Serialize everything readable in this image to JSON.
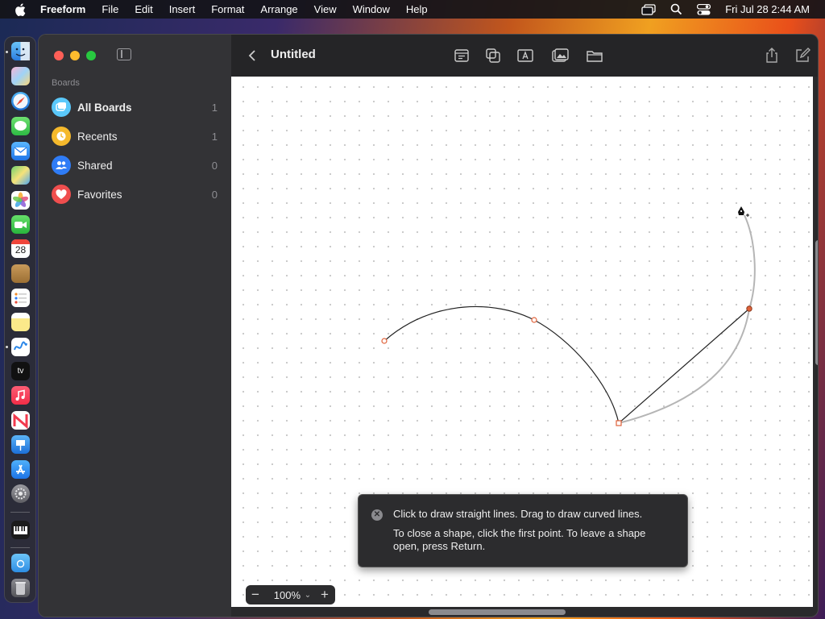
{
  "menubar": {
    "app_name": "Freeform",
    "menus": [
      "File",
      "Edit",
      "Insert",
      "Format",
      "Arrange",
      "View",
      "Window",
      "Help"
    ],
    "clock": "Fri Jul 28  2:44 AM"
  },
  "dock": {
    "calendar_day": "28",
    "tv_label": "tv"
  },
  "sidebar": {
    "section_title": "Boards",
    "items": [
      {
        "label": "All Boards",
        "count": "1",
        "icon": "all-boards-icon",
        "color": "#5ac8fa"
      },
      {
        "label": "Recents",
        "count": "1",
        "icon": "clock-icon",
        "color": "#f5b92c"
      },
      {
        "label": "Shared",
        "count": "0",
        "icon": "people-icon",
        "color": "#2f7cf6"
      },
      {
        "label": "Favorites",
        "count": "0",
        "icon": "heart-icon",
        "color": "#ef4e4e"
      }
    ]
  },
  "toolbar": {
    "title": "Untitled"
  },
  "tooltip": {
    "line1": "Click to draw straight lines. Drag to draw curved lines.",
    "line2": "To close a shape, click the first point. To leave a shape open, press Return."
  },
  "zoom": {
    "value": "100%",
    "minus": "−",
    "plus": "+"
  },
  "colors": {
    "accent_point": "#e0623a",
    "close_red": "#fe5f57",
    "minimize_yellow": "#febc2e",
    "zoom_green": "#28c840"
  }
}
